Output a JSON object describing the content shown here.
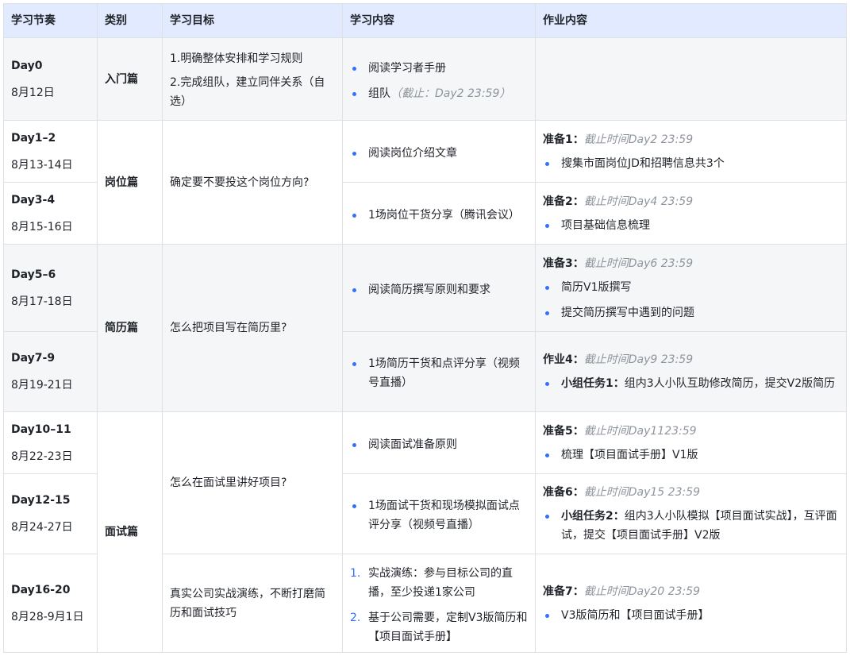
{
  "headers": [
    "学习节奏",
    "类别",
    "学习目标",
    "学习内容",
    "作业内容"
  ],
  "rows": {
    "r0": {
      "day": "Day0",
      "date": "8月12日",
      "category": "入门篇",
      "goals": [
        "1.明确整体安排和学习规则",
        "2.完成组队，建立同伴关系（自选）"
      ],
      "content1": "阅读学习者手册",
      "content2_text": "组队",
      "content2_note": "（截止：Day2 23:59）"
    },
    "r1": {
      "day": "Day1–2",
      "date": "8月13-14日",
      "content": "阅读岗位介绍文章",
      "hw_title": "准备1：",
      "hw_deadline": "截止时间Day2 23:59",
      "hw_item": "搜集市面岗位JD和招聘信息共3个"
    },
    "r2": {
      "day": "Day3-4",
      "date": "8月15-16日",
      "content": "1场岗位干货分享（腾讯会议）",
      "hw_title": "准备2：",
      "hw_deadline": "截止时间Day4 23:59",
      "hw_item": "项目基础信息梳理"
    },
    "sec_job": {
      "category": "岗位篇",
      "goal": "确定要不要投这个岗位方向?"
    },
    "r3": {
      "day": "Day5–6",
      "date": "8月17-18日",
      "content": "阅读简历撰写原则和要求",
      "hw_title": "准备3：",
      "hw_deadline": "截止时间Day6 23:59",
      "hw_item1": "简历V1版撰写",
      "hw_item2": "提交简历撰写中遇到的问题"
    },
    "r4": {
      "day": "Day7-9",
      "date": "8月19-21日",
      "content": "1场简历干货和点评分享（视频号直播）",
      "hw_title": "作业4：",
      "hw_deadline": "截止时间Day9 23:59",
      "hw_item_bold": "小组任务1：",
      "hw_item_text": "组内3人小队互助修改简历，提交V2版简历"
    },
    "sec_resume": {
      "category": "简历篇",
      "goal": "怎么把项目写在简历里?"
    },
    "r5": {
      "day": "Day10–11",
      "date": "8月22-23日",
      "content": "阅读面试准备原则",
      "hw_title": "准备5：",
      "hw_deadline": "截止时间Day1123:59",
      "hw_item": "梳理【项目面试手册】V1版"
    },
    "r6": {
      "day": "Day12-15",
      "date": "8月24-27日",
      "content": "1场面试干货和现场模拟面试点评分享（视频号直播）",
      "hw_title": "准备6：",
      "hw_deadline": "截止时间Day15 23:59",
      "hw_item_bold": "小组任务2：",
      "hw_item_text": "组内3人小队模拟【项目面试实战】，互评面试，提交【项目面试手册】V2版"
    },
    "sec_interview": {
      "category": "面试篇",
      "goal": "怎么在面试里讲好项目?"
    },
    "r7": {
      "day": "Day16-20",
      "date": "8月28-9月1日",
      "goal": "真实公司实战演练，不断打磨简历和面试技巧",
      "n1": "1.",
      "content1": "实战演练：参与目标公司的直播，至少投递1家公司",
      "n2": "2.",
      "content2": "基于公司需要，定制V3版简历和【项目面试手册】",
      "hw_title": "准备7：",
      "hw_deadline": "截止时间Day20 23:59",
      "hw_item": "V3版简历和【项目面试手册】"
    }
  }
}
